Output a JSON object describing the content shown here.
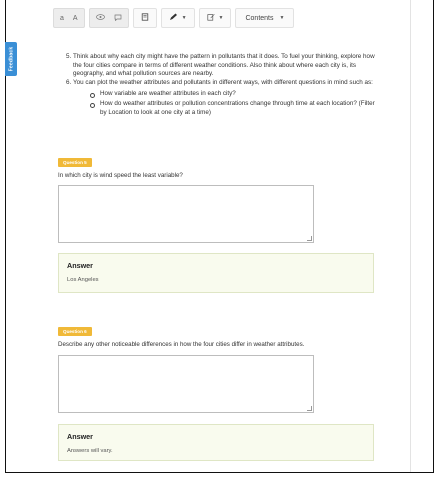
{
  "toolbar": {
    "format_group": {
      "left_label": "a",
      "right_label": "A"
    },
    "contents_label": "Contents"
  },
  "feedback_tab": {
    "label": "Feedback"
  },
  "instructions": {
    "items": [
      {
        "number": "5.",
        "text": "Think about why each city might have the pattern in pollutants that it does. To fuel your thinking, explore how the four cities compare in terms of different weather conditions. Also think about where each city is, its geography, and what pollution sources are nearby."
      },
      {
        "number": "6.",
        "text": "You can plot the weather attributes and pollutants in different ways, with different questions in mind such as:"
      }
    ],
    "sub_items": [
      "How variable are weather attributes in each city?",
      "How do weather attributes or pollution concentrations change through time at each location? (Filter by Location to look at one city at a time)"
    ]
  },
  "question5": {
    "badge": "Question 5",
    "prompt": "In which city is wind speed the least variable?",
    "answer_title": "Answer",
    "answer_text": "Los Angeles"
  },
  "question6": {
    "badge": "Question 6",
    "prompt": "Describe any other noticeable differences in how the four cities differ in weather attributes.",
    "answer_title": "Answer",
    "answer_text": "Answers will vary."
  },
  "colors": {
    "badge": "#f0b938",
    "answer_bg": "#f9fbee",
    "feedback": "#3a8fd6"
  }
}
